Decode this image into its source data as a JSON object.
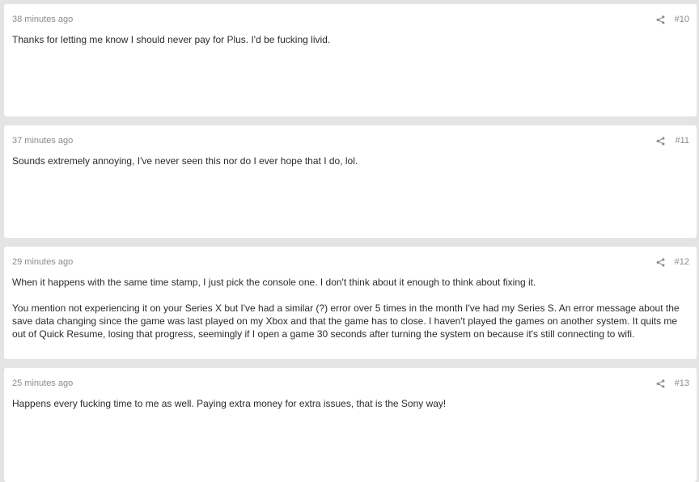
{
  "posts": [
    {
      "time": "38 minutes ago",
      "number": "#10",
      "paragraphs": [
        "Thanks for letting me know I should never pay for Plus. I'd be fucking livid."
      ]
    },
    {
      "time": "37 minutes ago",
      "number": "#11",
      "paragraphs": [
        "Sounds extremely annoying, I've never seen this nor do I ever hope that I do, lol."
      ]
    },
    {
      "time": "29 minutes ago",
      "number": "#12",
      "paragraphs": [
        "When it happens with the same time stamp, I just pick the console one. I don't think about it enough to think about fixing it.",
        "You mention not experiencing it on your Series X but I've had a similar (?) error over 5 times in the month I've had my Series S. An error message about the save data changing since the game was last played on my Xbox and that the game has to close. I haven't played the games on another system. It quits me out of Quick Resume, losing that progress, seemingly if I open a game 30 seconds after turning the system on because it's still connecting to wifi."
      ]
    },
    {
      "time": "25 minutes ago",
      "number": "#13",
      "paragraphs": [
        "Happens every fucking time to me as well. Paying extra money for extra issues, that is the Sony way!"
      ]
    }
  ]
}
